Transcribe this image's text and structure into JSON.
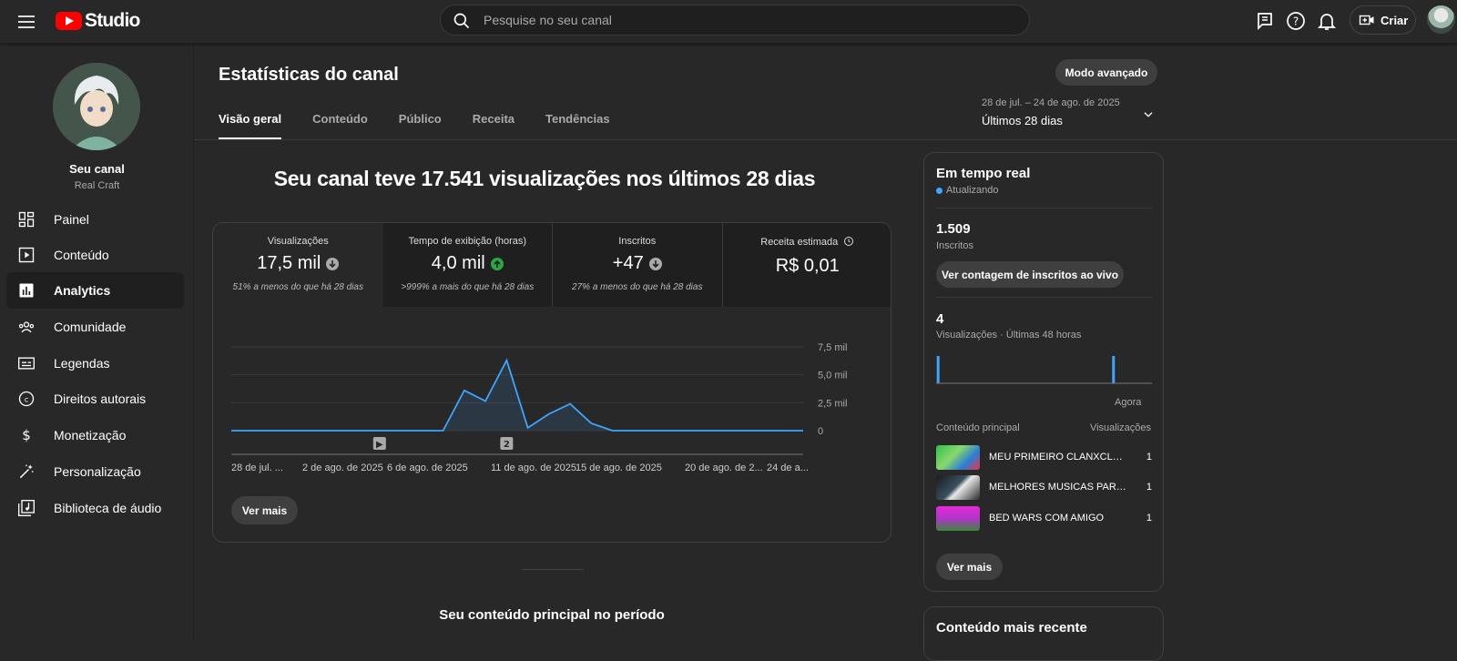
{
  "header": {
    "logo_text": "Studio",
    "search_placeholder": "Pesquise no seu canal",
    "create_label": "Criar"
  },
  "channel": {
    "name": "Seu canal",
    "handle": "Real Craft"
  },
  "sidebar": {
    "items": [
      {
        "label": "Painel",
        "icon": "dashboard-icon"
      },
      {
        "label": "Conteúdo",
        "icon": "content-icon"
      },
      {
        "label": "Analytics",
        "icon": "analytics-icon"
      },
      {
        "label": "Comunidade",
        "icon": "community-icon"
      },
      {
        "label": "Legendas",
        "icon": "subtitles-icon"
      },
      {
        "label": "Direitos autorais",
        "icon": "copyright-icon"
      },
      {
        "label": "Monetização",
        "icon": "monetization-icon"
      },
      {
        "label": "Personalização",
        "icon": "customization-icon"
      },
      {
        "label": "Biblioteca de áudio",
        "icon": "audio-library-icon"
      }
    ]
  },
  "page": {
    "title": "Estatísticas do canal",
    "advanced_button": "Modo avançado",
    "tabs": [
      "Visão geral",
      "Conteúdo",
      "Público",
      "Receita",
      "Tendências"
    ],
    "period": {
      "range": "28 de jul. – 24 de ago. de 2025",
      "label": "Últimos 28 dias"
    },
    "headline": "Seu canal teve 17.541 visualizações nos últimos 28 dias",
    "see_more": "Ver mais",
    "sub_heading": "Seu conteúdo principal no período"
  },
  "metrics": [
    {
      "title": "Visualizações",
      "value": "17,5 mil",
      "trend": "down",
      "compare": "51% a menos do que há 28 dias"
    },
    {
      "title": "Tempo de exibição (horas)",
      "value": "4,0 mil",
      "trend": "up",
      "compare": ">999% a mais do que há 28 dias"
    },
    {
      "title": "Inscritos",
      "value": "+47",
      "trend": "down",
      "compare": "27% a menos do que há 28 dias"
    },
    {
      "title": "Receita estimada",
      "value": "R$ 0,01",
      "trend": "none",
      "compare": ""
    }
  ],
  "chart_data": {
    "type": "area",
    "title": "",
    "x_tick_labels": [
      "28 de jul. ...",
      "2 de ago. de 2025",
      "6 de ago. de 2025",
      "11 de ago. de 2025",
      "15 de ago. de 2025",
      "20 de ago. de 2...",
      "24 de a..."
    ],
    "y_tick_labels": [
      "0",
      "2,5 mil",
      "5,0 mil",
      "7,5 mil"
    ],
    "ylim": [
      0,
      7500
    ],
    "x": [
      "28 jul",
      "29 jul",
      "30 jul",
      "31 jul",
      "1 ago",
      "2 ago",
      "3 ago",
      "4 ago",
      "5 ago",
      "6 ago",
      "7 ago",
      "8 ago",
      "9 ago",
      "10 ago",
      "11 ago",
      "12 ago",
      "13 ago",
      "14 ago",
      "15 ago",
      "16 ago",
      "17 ago",
      "18 ago",
      "19 ago",
      "20 ago",
      "21 ago",
      "22 ago",
      "23 ago",
      "24 ago"
    ],
    "series": [
      {
        "values": [
          0,
          0,
          0,
          0,
          0,
          0,
          0,
          0,
          0,
          0,
          0,
          3600,
          2650,
          6300,
          250,
          1500,
          2400,
          650,
          0,
          0,
          0,
          0,
          0,
          0,
          0,
          0,
          0,
          0
        ]
      }
    ],
    "markers": [
      {
        "date": "4 ago",
        "label": "▶"
      },
      {
        "date": "10 ago",
        "label": "2"
      }
    ],
    "grid": true,
    "color": "#3ea6ff"
  },
  "realtime": {
    "title": "Em tempo real",
    "status": "Atualizando",
    "subs_value": "1.509",
    "subs_label": "Inscritos",
    "live_button": "Ver contagem de inscritos ao vivo",
    "views_value": "4",
    "views_label": "Visualizações · Últimas 48 horas",
    "now_label": "Agora",
    "bars": [
      1,
      0,
      0,
      0,
      0,
      0,
      0,
      0,
      0,
      0,
      0,
      0,
      0,
      0,
      0,
      0,
      0,
      0,
      0,
      0,
      0,
      0,
      0,
      0,
      0,
      0,
      0,
      0,
      0,
      0,
      0,
      0,
      0,
      0,
      0,
      0,
      0,
      0,
      0,
      1,
      0,
      0,
      0,
      0,
      0,
      0,
      0,
      0
    ],
    "col_content": "Conteúdo principal",
    "col_views": "Visualizações",
    "videos": [
      {
        "title": "MEU PRIMEIRO CLANXCLAN NO BLOCKMAN GO",
        "views": "1"
      },
      {
        "title": "MELHORES MUSICAS PARA JOGAR",
        "views": "1"
      },
      {
        "title": "BED WARS COM AMIGO",
        "views": "1"
      }
    ],
    "see_more": "Ver mais"
  },
  "recent": {
    "title": "Conteúdo mais recente"
  }
}
